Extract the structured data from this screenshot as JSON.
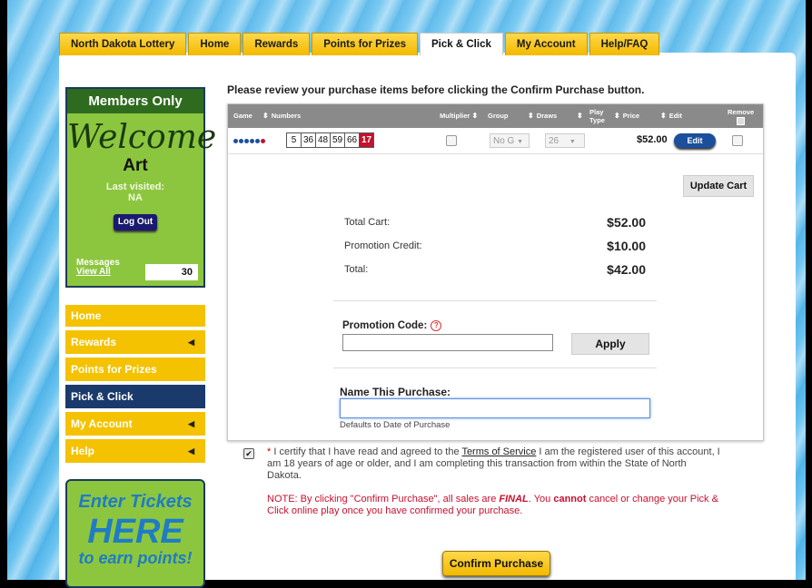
{
  "tabs": [
    "North Dakota Lottery",
    "Home",
    "Rewards",
    "Points for Prizes",
    "Pick & Click",
    "My Account",
    "Help/FAQ"
  ],
  "active_tab": "Pick & Click",
  "sidebar": {
    "members_title": "Members Only",
    "welcome": "Welcome",
    "name": "Art",
    "last_visited_label": "Last visited:",
    "last_visited_value": "NA",
    "logout_label": "Log Out",
    "messages_label": "Messages",
    "view_all_label": "View All",
    "messages_count": "30",
    "nav": [
      {
        "label": "Home",
        "caret": ""
      },
      {
        "label": "Rewards",
        "caret": "◀"
      },
      {
        "label": "Points for Prizes",
        "caret": ""
      },
      {
        "label": "Pick & Click",
        "caret": ""
      },
      {
        "label": "My Account",
        "caret": "◀"
      },
      {
        "label": "Help",
        "caret": "◀"
      }
    ],
    "enter_line1": "Enter Tickets",
    "enter_line2": "HERE",
    "enter_line3": "to earn points!"
  },
  "main": {
    "instruction": "Please review your purchase items before clicking the Confirm Purchase button.",
    "columns": {
      "game": "Game",
      "numbers": "Numbers",
      "multiplier": "Multiplier",
      "group": "Group",
      "draws": "Draws",
      "play_type": "Play Type",
      "price": "Price",
      "edit": "Edit",
      "remove": "Remove"
    },
    "row": {
      "numbers": [
        "5",
        "36",
        "48",
        "59",
        "66"
      ],
      "bonus": "17",
      "group": "No G",
      "draws": "26",
      "price": "$52.00",
      "edit_label": "Edit"
    },
    "update_cart": "Update Cart",
    "totals": [
      {
        "label": "Total Cart:",
        "value": "$52.00"
      },
      {
        "label": "Promotion Credit:",
        "value": "$10.00"
      },
      {
        "label": "Total:",
        "value": "$42.00"
      }
    ],
    "promo_label": "Promotion Code:",
    "promo_help": "?",
    "promo_value": "",
    "apply_label": "Apply",
    "name_label": "Name This Purchase:",
    "name_value": "",
    "name_hint": "Defaults to Date of Purchase"
  },
  "certify": {
    "checkbox": "✔",
    "star": "*",
    "text_before": " I certify that I have read and agreed to the ",
    "tos": "Terms of Service",
    "text_after": " I am the registered user of this account, I am 18 years of age or older, and I am completing this transaction from within the State of North Dakota."
  },
  "note": {
    "before": "NOTE: By clicking \"Confirm Purchase\", all sales are ",
    "final": "FINAL",
    "mid": ". You ",
    "cannot": "cannot",
    "after": " cancel or change your Pick & Click online play once you have confirmed your purchase."
  },
  "confirm_label": "Confirm Purchase",
  "colors": {
    "tab_yellow": "#f2b900",
    "sidebar_green": "#8cc63f",
    "nav_active": "#1b3a6c",
    "bonus_red": "#c4122f",
    "edit_blue": "#1b4f9c",
    "note_red": "#c8102e"
  }
}
